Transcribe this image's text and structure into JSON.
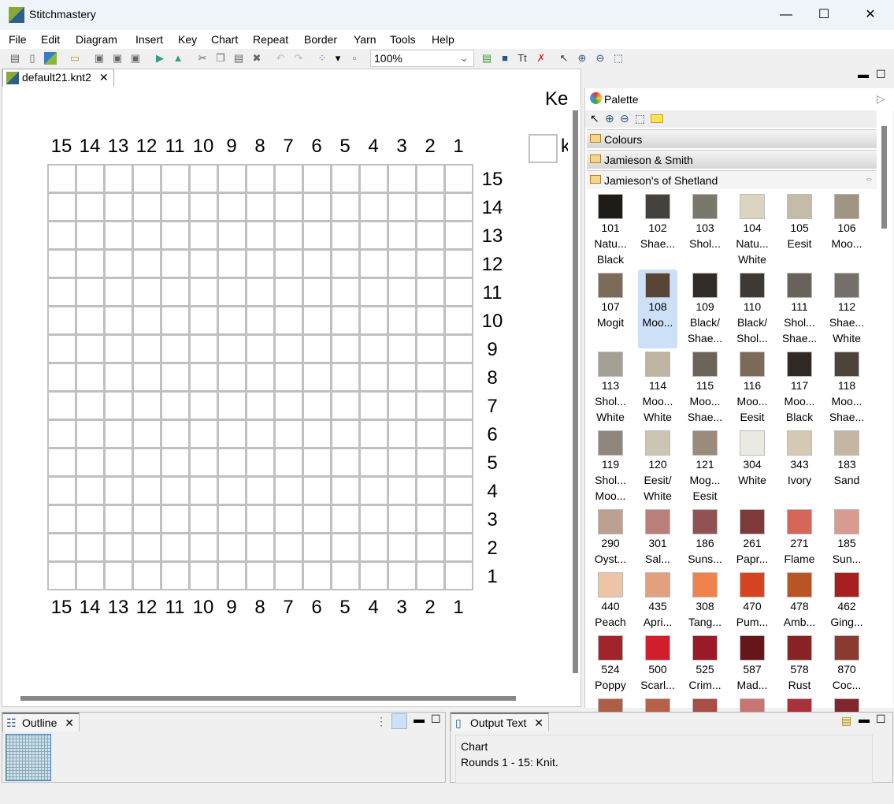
{
  "window": {
    "title": "Stitchmastery",
    "minimize": "—",
    "maximize": "☐",
    "close": "✕"
  },
  "menu": [
    "File",
    "Edit",
    "Diagram",
    "Insert",
    "Key",
    "Chart",
    "Repeat",
    "Border",
    "Yarn",
    "Tools",
    "Help"
  ],
  "toolbar": {
    "zoom": "100%"
  },
  "editor": {
    "tab": "default21.knt2",
    "close": "✕"
  },
  "chart": {
    "columns": [
      15,
      14,
      13,
      12,
      11,
      10,
      9,
      8,
      7,
      6,
      5,
      4,
      3,
      2,
      1
    ],
    "rows": [
      15,
      14,
      13,
      12,
      11,
      10,
      9,
      8,
      7,
      6,
      5,
      4,
      3,
      2,
      1
    ],
    "stitch": "Knit"
  },
  "key": {
    "title": "Ke",
    "item": "k"
  },
  "palette": {
    "title": "Palette",
    "drawers": [
      "Colours",
      "Jamieson & Smith",
      "Jamieson's of Shetland"
    ],
    "swatches": [
      {
        "c": "#1f1c18",
        "l": [
          "101",
          "Natu...",
          "Black"
        ]
      },
      {
        "c": "#45413d",
        "l": [
          "102",
          "Shae..."
        ]
      },
      {
        "c": "#7a776b",
        "l": [
          "103",
          "Shol..."
        ]
      },
      {
        "c": "#dbd5c0",
        "l": [
          "104",
          "Natu...",
          "White"
        ]
      },
      {
        "c": "#c5bca8",
        "l": [
          "105",
          "Eesit"
        ]
      },
      {
        "c": "#a09583",
        "l": [
          "106",
          "Moo..."
        ]
      },
      {
        "c": "#7d6b5a",
        "l": [
          "107",
          "Mogit"
        ]
      },
      {
        "c": "#574535",
        "l": [
          "108",
          "Moo..."
        ],
        "selected": true
      },
      {
        "c": "#322c28",
        "l": [
          "109",
          "Black/",
          "Shae..."
        ]
      },
      {
        "c": "#3d3935",
        "l": [
          "110",
          "Black/",
          "Shol..."
        ]
      },
      {
        "c": "#67625a",
        "l": [
          "111",
          "Shol...",
          "Shae..."
        ]
      },
      {
        "c": "#747069",
        "l": [
          "112",
          "Shae...",
          "White"
        ]
      },
      {
        "c": "#a4a093",
        "l": [
          "113",
          "Shol...",
          "White"
        ]
      },
      {
        "c": "#beb4a2",
        "l": [
          "114",
          "Moo...",
          "White"
        ]
      },
      {
        "c": "#6b6459",
        "l": [
          "115",
          "Moo...",
          "Shae..."
        ]
      },
      {
        "c": "#7b6a58",
        "l": [
          "116",
          "Moo...",
          "Eesit"
        ]
      },
      {
        "c": "#302822",
        "l": [
          "117",
          "Moo...",
          "Black"
        ]
      },
      {
        "c": "#4c443a",
        "l": [
          "118",
          "Moo...",
          "Shae..."
        ]
      },
      {
        "c": "#8f877c",
        "l": [
          "119",
          "Shol...",
          "Moo..."
        ]
      },
      {
        "c": "#cbc6b3",
        "l": [
          "120",
          "Eesit/",
          "White"
        ]
      },
      {
        "c": "#9a8b7c",
        "l": [
          "121",
          "Mog...",
          "Eesit"
        ]
      },
      {
        "c": "#eaeae3",
        "l": [
          "304",
          "White"
        ]
      },
      {
        "c": "#d4c9b3",
        "l": [
          "343",
          "Ivory"
        ]
      },
      {
        "c": "#c5b6a2",
        "l": [
          "183",
          "Sand"
        ]
      },
      {
        "c": "#bb9f8f",
        "l": [
          "290",
          "Oyst..."
        ]
      },
      {
        "c": "#b97f7a",
        "l": [
          "301",
          "Sal..."
        ]
      },
      {
        "c": "#925152",
        "l": [
          "186",
          "Suns..."
        ]
      },
      {
        "c": "#7d3a38",
        "l": [
          "261",
          "Papr..."
        ]
      },
      {
        "c": "#d4665a",
        "l": [
          "271",
          "Flame"
        ]
      },
      {
        "c": "#d99a8f",
        "l": [
          "185",
          "Sun..."
        ]
      },
      {
        "c": "#ecc4a6",
        "l": [
          "440",
          "Peach"
        ]
      },
      {
        "c": "#e2a07e",
        "l": [
          "435",
          "Apri..."
        ]
      },
      {
        "c": "#f0834c",
        "l": [
          "308",
          "Tang..."
        ]
      },
      {
        "c": "#d74422",
        "l": [
          "470",
          "Pum..."
        ]
      },
      {
        "c": "#b95425",
        "l": [
          "478",
          "Amb..."
        ]
      },
      {
        "c": "#a81f1f",
        "l": [
          "462",
          "Ging..."
        ]
      },
      {
        "c": "#a0242a",
        "l": [
          "524",
          "Poppy"
        ]
      },
      {
        "c": "#d11e2c",
        "l": [
          "500",
          "Scarl..."
        ]
      },
      {
        "c": "#9a1a28",
        "l": [
          "525",
          "Crim..."
        ]
      },
      {
        "c": "#66151b",
        "l": [
          "587",
          "Mad..."
        ]
      },
      {
        "c": "#862424",
        "l": [
          "578",
          "Rust"
        ]
      },
      {
        "c": "#8a3a2e",
        "l": [
          "870",
          "Coc..."
        ]
      },
      {
        "c": "#ae5e45",
        "l": []
      },
      {
        "c": "#b6614a",
        "l": []
      },
      {
        "c": "#a84e47",
        "l": []
      },
      {
        "c": "#c97571",
        "l": []
      },
      {
        "c": "#a8323a",
        "l": []
      },
      {
        "c": "#81262c",
        "l": []
      }
    ]
  },
  "outline": {
    "tab": "Outline",
    "close": "✕"
  },
  "output": {
    "tab": "Output Text",
    "close": "✕",
    "lines": [
      "Chart",
      "Rounds 1 - 15: Knit."
    ]
  }
}
